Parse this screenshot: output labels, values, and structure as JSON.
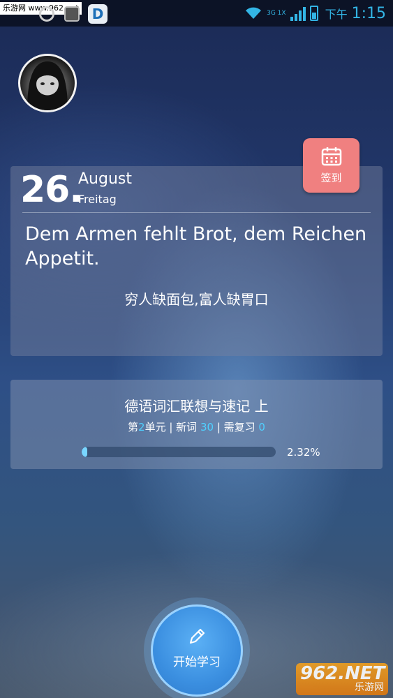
{
  "status_bar": {
    "watermark": "乐游网 www.962.net",
    "app_icon_letter": "D",
    "network_label": "3G 1X",
    "ampm": "下午",
    "time": "1:15",
    "accent_color": "#33b5e5"
  },
  "daily": {
    "day": "26.",
    "month": "August",
    "weekday": "Freitag",
    "quote_de": "Dem Armen fehlt Brot, dem Reichen Appetit.",
    "quote_zh": "穷人缺面包,富人缺胃口"
  },
  "checkin": {
    "label": "签到",
    "icon": "calendar-icon",
    "color": "#f08080"
  },
  "course": {
    "title": "德语词汇联想与速记 上",
    "unit_prefix": "第",
    "unit_number": "2",
    "unit_suffix": "单元 | 新词 ",
    "new_words": "30",
    "review_prefix": " | 需复习 ",
    "review_count": "0",
    "progress_text": "2.32%",
    "progress_value": 0.0232
  },
  "start_button": {
    "label": "开始学习",
    "icon": "pencil-icon"
  },
  "watermark_logo": {
    "big": "962.NET",
    "small": "乐游网"
  }
}
